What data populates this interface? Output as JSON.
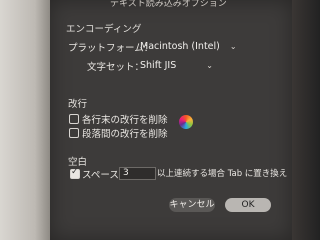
{
  "window": {
    "title": "テキスト読み込みオプション"
  },
  "encoding": {
    "heading": "エンコーディング",
    "platform_label": "プラットフォーム：",
    "platform_value": "Macintosh (Intel)",
    "charset_label": "文字セット：",
    "charset_value": "Shift JIS"
  },
  "linebreak": {
    "heading": "改行",
    "remove_line_end": "各行末の改行を削除",
    "remove_para": "段落間の改行を削除"
  },
  "whitespace": {
    "heading": "空白",
    "spaces_label": "スペースが",
    "spaces_value": "3",
    "tab_replace_label": "以上連続する場合 Tab に置き換え",
    "checked": true
  },
  "buttons": {
    "cancel": "キャンセル",
    "ok": "OK"
  },
  "icons": {
    "busy": "spinning-wait-cursor"
  }
}
